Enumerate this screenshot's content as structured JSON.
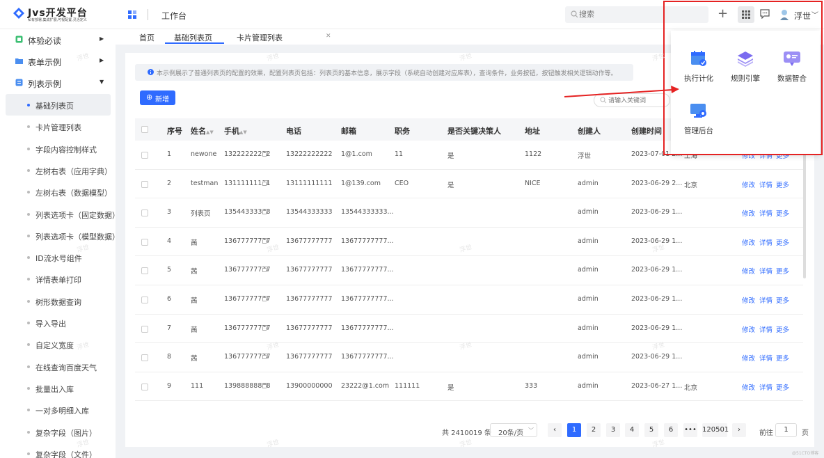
{
  "header": {
    "logo_title": "Jvs开发平台",
    "logo_subtitle": "私有部署,集成扩展,可视配置,灵活定义",
    "workbench": "工作台",
    "search_placeholder": "搜索",
    "user_name": "浮世"
  },
  "sidebar": {
    "groups": [
      {
        "label": "体验必读",
        "icon": "book-icon"
      },
      {
        "label": "表单示例",
        "icon": "folder-icon"
      },
      {
        "label": "列表示例",
        "icon": "list-icon"
      }
    ],
    "sub_items": [
      "基础列表页",
      "卡片管理列表",
      "字段内容控制样式",
      "左树右表（应用字典）",
      "左树右表（数据模型）",
      "列表选项卡（固定数据）",
      "列表选项卡（模型数据）",
      "ID流水号组件",
      "详情表单打印",
      "树形数据查询",
      "导入导出",
      "自定义宽度",
      "在线查询百度天气",
      "批量出入库",
      "一对多明细入库",
      "复杂字段（图片）",
      "复杂字段（文件）"
    ],
    "active_index": 0
  },
  "tabs": [
    "首页",
    "基础列表页",
    "卡片管理列表"
  ],
  "active_tab": 1,
  "notice": "本示例展示了普通列表页的配置的效果，配置列表页包括：列表页的基本信息，展示字段（系统自动创建对应库表），查询条件，业务按钮，按钮触发相关逻辑动作等。",
  "new_button": "新增",
  "keyword_placeholder": "请输入关键词",
  "table": {
    "columns": [
      "序号",
      "姓名",
      "手机",
      "电话",
      "邮箱",
      "职务",
      "是否关键决策人",
      "地址",
      "创建人",
      "创建时间"
    ],
    "rows": [
      {
        "no": "1",
        "name": "newone",
        "mobile": "13222222222",
        "phone": "13222222222",
        "email": "1@1.com",
        "title": "11",
        "key": "是",
        "addr": "1122",
        "creator": "浮世",
        "created": "2023-07-01 2...",
        "loc": "上海"
      },
      {
        "no": "2",
        "name": "testman",
        "mobile": "13111111111",
        "phone": "13111111111",
        "email": "1@139.com",
        "title": "CEO",
        "key": "是",
        "addr": "NICE",
        "creator": "admin",
        "created": "2023-06-29 2...",
        "loc": "北京"
      },
      {
        "no": "3",
        "name": "列表页",
        "mobile": "13544333333",
        "phone": "13544333333",
        "email": "13544333333...",
        "title": "",
        "key": "",
        "addr": "",
        "creator": "admin",
        "created": "2023-06-29 1...",
        "loc": ""
      },
      {
        "no": "4",
        "name": "茜",
        "mobile": "13677777777",
        "phone": "13677777777",
        "email": "13677777777...",
        "title": "",
        "key": "",
        "addr": "",
        "creator": "admin",
        "created": "2023-06-29 1...",
        "loc": ""
      },
      {
        "no": "5",
        "name": "茜",
        "mobile": "13677777777",
        "phone": "13677777777",
        "email": "13677777777...",
        "title": "",
        "key": "",
        "addr": "",
        "creator": "admin",
        "created": "2023-06-29 1...",
        "loc": ""
      },
      {
        "no": "6",
        "name": "茜",
        "mobile": "13677777777",
        "phone": "13677777777",
        "email": "13677777777...",
        "title": "",
        "key": "",
        "addr": "",
        "creator": "admin",
        "created": "2023-06-29 1...",
        "loc": ""
      },
      {
        "no": "7",
        "name": "茜",
        "mobile": "13677777777",
        "phone": "13677777777",
        "email": "13677777777...",
        "title": "",
        "key": "",
        "addr": "",
        "creator": "admin",
        "created": "2023-06-29 1...",
        "loc": ""
      },
      {
        "no": "8",
        "name": "茜",
        "mobile": "13677777777",
        "phone": "13677777777",
        "email": "13677777777...",
        "title": "",
        "key": "",
        "addr": "",
        "creator": "admin",
        "created": "2023-06-29 1...",
        "loc": ""
      },
      {
        "no": "9",
        "name": "111",
        "mobile": "13988888888",
        "phone": "13900000000",
        "email": "23222@1.com",
        "title": "111111",
        "key": "是",
        "addr": "333",
        "creator": "admin",
        "created": "2023-06-27 1...",
        "loc": "北京"
      }
    ],
    "actions": [
      "修改",
      "详情",
      "更多"
    ]
  },
  "pager": {
    "total": "共 2410019 条",
    "page_size": "20条/页",
    "pages": [
      "1",
      "2",
      "3",
      "4",
      "5",
      "6",
      "•••",
      "120501"
    ],
    "goto_label": "前往",
    "goto_value": "1",
    "page_label": "页"
  },
  "app_popup": {
    "items": [
      {
        "label": "执行计化",
        "icon": "calendar-check-icon"
      },
      {
        "label": "规则引擎",
        "icon": "layers-icon"
      },
      {
        "label": "数据智合",
        "icon": "data-card-icon"
      },
      {
        "label": "管理后台",
        "icon": "monitor-gear-icon"
      }
    ]
  },
  "watermark": "浮世",
  "corner_watermark": "@51CTO博客",
  "colors": {
    "accent": "#2f6bff",
    "highlight_box": "#e52222"
  }
}
